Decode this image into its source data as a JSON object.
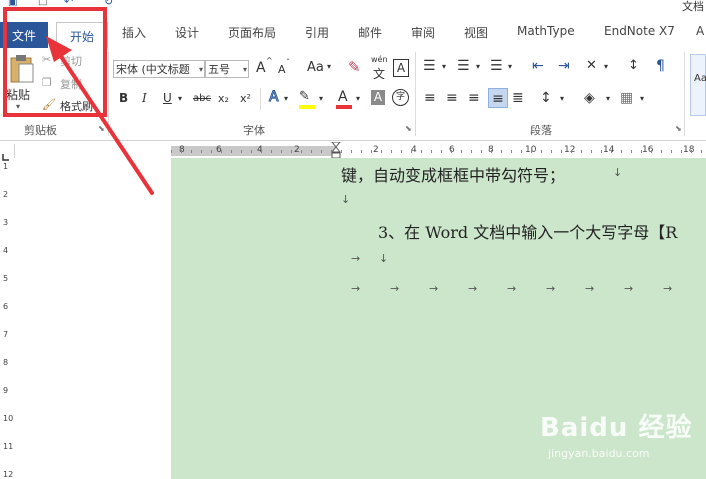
{
  "window": {
    "title_partial": "文档"
  },
  "tabs": [
    {
      "label": "文件"
    },
    {
      "label": "开始"
    },
    {
      "label": "插入"
    },
    {
      "label": "设计"
    },
    {
      "label": "页面布局"
    },
    {
      "label": "引用"
    },
    {
      "label": "邮件"
    },
    {
      "label": "审阅"
    },
    {
      "label": "视图"
    },
    {
      "label": "MathType"
    },
    {
      "label": "EndNote X7"
    },
    {
      "label": "A"
    }
  ],
  "clipboard": {
    "paste": "粘贴",
    "cut": "剪切",
    "copy": "复制",
    "format_painter": "格式刷",
    "group_label": "剪贴板"
  },
  "font": {
    "name": "宋体 (中文标题",
    "size": "五号",
    "group_label": "字体",
    "grow": "A",
    "shrink": "A",
    "case": "Aa",
    "wen": "wén",
    "wen_char": "文",
    "border_char": "A",
    "bold": "B",
    "italic": "I",
    "underline": "U",
    "strike": "abc",
    "sub": "x₂",
    "sup": "x²",
    "effect": "A",
    "highlight_color": "#ffff00",
    "font_color": "#e8333a",
    "shade_char": "A",
    "enclose_char": "字"
  },
  "paragraph": {
    "group_label": "段落"
  },
  "styles": {
    "preview": "Aa"
  },
  "ruler": {
    "h_numbers": [
      "8",
      "6",
      "4",
      "2",
      "2",
      "4",
      "6",
      "8",
      "10",
      "12",
      "14",
      "16",
      "18"
    ],
    "v_numbers": [
      "1",
      "2",
      "3",
      "4",
      "5",
      "6",
      "7",
      "8",
      "9",
      "10",
      "11",
      "12"
    ]
  },
  "document": {
    "line1": "键，自动变成框框中带勾符号；",
    "line2": "3、在 Word 文档中输入一个大写字母【R",
    "para_mark": "↓",
    "tab_mark": "→"
  },
  "watermark": {
    "main": "Baidu 经验",
    "sub": "jingyan.baidu.com"
  },
  "colors": {
    "file_tab": "#2b579a",
    "annotation": "#e8333a",
    "doc_bg": "#cce6cc"
  }
}
